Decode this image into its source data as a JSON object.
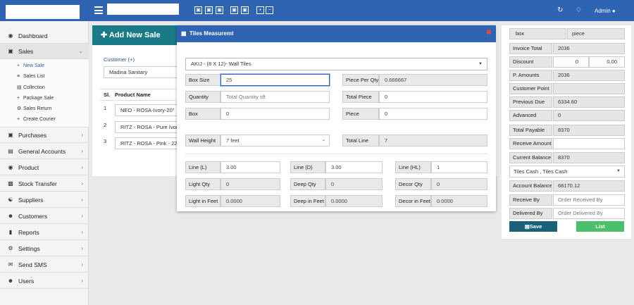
{
  "topbar": {
    "toolbar_icons": [
      "cart-icon",
      "cart-icon",
      "cart-icon",
      "cart-icon",
      "cart-icon",
      "plus-box-icon",
      "minus-box-icon"
    ],
    "admin_label": "Admin"
  },
  "sidebar": {
    "items": [
      {
        "label": "Dashboard",
        "icon": "dashboard-icon"
      },
      {
        "label": "Sales",
        "icon": "cart-icon"
      },
      {
        "label": "Purchases",
        "icon": "cart-icon"
      },
      {
        "label": "General Accounts",
        "icon": "accounts-icon"
      },
      {
        "label": "Product",
        "icon": "product-icon"
      },
      {
        "label": "Stock Transfer",
        "icon": "truck-icon"
      },
      {
        "label": "Suppliers",
        "icon": "handshake-icon"
      },
      {
        "label": "Customers",
        "icon": "users-icon"
      },
      {
        "label": "Reports",
        "icon": "book-icon"
      },
      {
        "label": "Settings",
        "icon": "gear-icon"
      },
      {
        "label": "Send SMS",
        "icon": "envelope-icon"
      },
      {
        "label": "Users",
        "icon": "users-icon"
      }
    ],
    "sales_sub": [
      "New Sale",
      "Sales List",
      "Collection",
      "Package Sale",
      "Sales Return",
      "Create Courier"
    ]
  },
  "main": {
    "title": "Add New Sale",
    "customer_label": "Customer (+)",
    "customer_value": "Madina Sanitary",
    "table_headers": [
      "Sl.",
      "Product Name"
    ],
    "rows": [
      {
        "sl": "1",
        "product": "NEO - ROSA-Ivory-20\""
      },
      {
        "sl": "2",
        "product": "RITZ - ROSA - Pure Ivory"
      },
      {
        "sl": "3",
        "product": "RITZ - ROSA - Pink - 22\""
      }
    ]
  },
  "modal": {
    "title": "Tiles Measuremt",
    "product_select": "AKIJ - (8 X 12)- Wall Tiles",
    "box_size_label": "Box Size",
    "box_size_value": "25",
    "piece_per_qty_label": "Piece Per Qty",
    "piece_per_qty_value": "0.666667",
    "quantity_label": "Quantity",
    "quantity_placeholder": "Total Quantity sft",
    "total_piece_label": "Total Piece",
    "total_piece_value": "0",
    "box_label": "Box",
    "box_value": "0",
    "piece_label": "Piece",
    "piece_value": "0",
    "wall_height_label": "Wall Height",
    "wall_height_value": "7 feet",
    "total_line_label": "Total Line",
    "total_line_value": "7",
    "line_l_label": "Line (L)",
    "line_l_value": "3.00",
    "line_d_label": "Line (D)",
    "line_d_value": "3.00",
    "line_hl_label": "Line (HL)",
    "line_hl_value": "1",
    "light_qty_label": "Light Qty",
    "light_qty_value": "0",
    "deep_qty_label": "Deep Qty",
    "deep_qty_value": "0",
    "decor_qty_label": "Decor Qty",
    "decor_qty_value": "0",
    "light_feet_label": "Light in Feet",
    "light_feet_value": "0.0000",
    "deep_feet_label": "Deep in Feet",
    "deep_feet_value": "0.0000",
    "decor_feet_label": "Decor in Feet",
    "decor_feet_value": "0.0000"
  },
  "summary": {
    "box_label": "box",
    "piece_label": "piece",
    "invoice_total_label": "Invoice Total",
    "invoice_total_value": "2036",
    "discount_label": "Discount",
    "discount_value": "0",
    "discount_percent": "0.00",
    "p_amounts_label": "P. Amounts",
    "p_amounts_value": "2036",
    "customer_point_label": "Customer Point",
    "customer_point_value": "",
    "previous_due_label": "Previous Due",
    "previous_due_value": "6334.60",
    "advanced_label": "Advanced",
    "advanced_value": "0",
    "total_payable_label": "Total Payable",
    "total_payable_value": "8370",
    "receive_amount_label": "Receive Amount",
    "receive_amount_value": "",
    "current_balance_label": "Current Balance",
    "current_balance_value": "8370",
    "payment_select": "Tiles Cash , Tiles Cash",
    "account_balance_label": "Account Balance:",
    "account_balance_value": "68170.12",
    "receive_by_label": "Receive By",
    "receive_by_placeholder": "Order Received By",
    "delivered_by_label": "Delivered By",
    "delivered_by_placeholder": "Order Delivered By",
    "save_label": "Save",
    "list_label": "List"
  },
  "colors": {
    "header_blue": "#2f64b2",
    "teal_header": "#1a7a86",
    "save_button": "#1b5f78",
    "list_button": "#4bbf6b",
    "close_red": "#e74c3c"
  }
}
